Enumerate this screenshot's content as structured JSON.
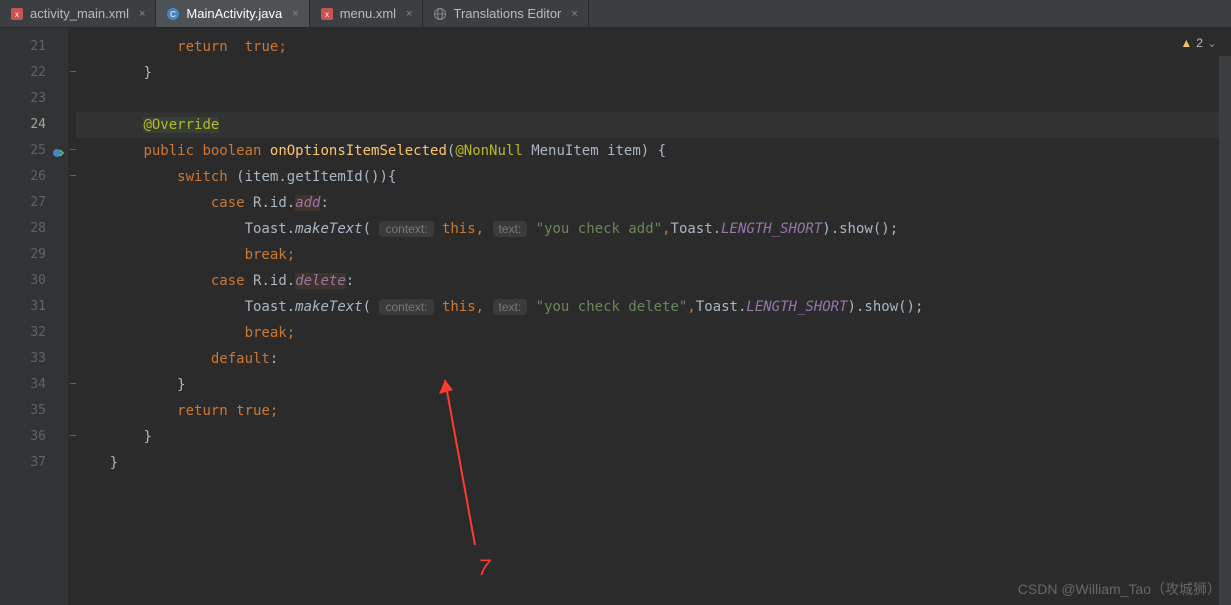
{
  "tabs": [
    {
      "label": "activity_main.xml",
      "icon": "xml-file-icon",
      "active": false
    },
    {
      "label": "MainActivity.java",
      "icon": "java-class-icon",
      "active": true
    },
    {
      "label": "menu.xml",
      "icon": "xml-file-icon",
      "active": false
    },
    {
      "label": "Translations Editor",
      "icon": "globe-icon",
      "active": false
    }
  ],
  "warnings": {
    "count": "2"
  },
  "gutter": {
    "start": 21,
    "end": 37,
    "current": 24,
    "override_marker_line": 25
  },
  "code": {
    "line21": {
      "indent": "            ",
      "kw": "return",
      "sp": "  ",
      "val": "true",
      "semi": ";"
    },
    "line22": {
      "indent": "        ",
      "brace": "}"
    },
    "line23": {
      "indent": ""
    },
    "line24": {
      "indent": "        ",
      "annot": "@Override"
    },
    "line25": {
      "indent": "        ",
      "pub": "public ",
      "bool": "boolean ",
      "method": "onOptionsItemSelected",
      "open": "(",
      "ann": "@NonNull ",
      "type": "MenuItem ",
      "param": "item",
      "close": ") {",
      "close_brace": " {"
    },
    "line26": {
      "indent": "            ",
      "kw": "switch ",
      "open": "(",
      "obj": "item",
      "dot": ".",
      "call": "getItemId",
      "paren": "()",
      "close": "){"
    },
    "line27": {
      "indent": "                ",
      "kw": "case ",
      "cls": "R",
      "d1": ".",
      "ns": "id",
      "d2": ".",
      "fld": "add",
      "colon": ":"
    },
    "line28": {
      "indent": "                    ",
      "cls": "Toast",
      "dot": ".",
      "mthd": "makeText",
      "open": "( ",
      "hint1": "context:",
      "sp1": " ",
      "thiskw": "this",
      "comma1": ", ",
      "hint2": "text:",
      "sp2": " ",
      "str": "\"you check add\"",
      "comma2": ",",
      "cls2": "Toast",
      "dot2": ".",
      "const": "LENGTH_SHORT",
      "close": ").",
      "show": "show",
      "end": "();"
    },
    "line29": {
      "indent": "                    ",
      "kw": "break",
      "semi": ";"
    },
    "line30": {
      "indent": "                ",
      "kw": "case ",
      "cls": "R",
      "d1": ".",
      "ns": "id",
      "d2": ".",
      "fld": "delete",
      "colon": ":"
    },
    "line31": {
      "indent": "                    ",
      "cls": "Toast",
      "dot": ".",
      "mthd": "makeText",
      "open": "( ",
      "hint1": "context:",
      "sp1": " ",
      "thiskw": "this",
      "comma1": ", ",
      "hint2": "text:",
      "sp2": " ",
      "str": "\"you check delete\"",
      "comma2": ",",
      "cls2": "Toast",
      "dot2": ".",
      "const": "LENGTH_SHORT",
      "close": ").",
      "show": "show",
      "end": "();"
    },
    "line32": {
      "indent": "                    ",
      "kw": "break",
      "semi": ";"
    },
    "line33": {
      "indent": "                ",
      "kw": "default",
      "colon": ":"
    },
    "line34": {
      "indent": "            ",
      "brace": "}"
    },
    "line35": {
      "indent": "            ",
      "kw": "return ",
      "val": "true",
      "semi": ";"
    },
    "line36": {
      "indent": "        ",
      "brace": "}"
    },
    "line37": {
      "indent": "    ",
      "brace": "}"
    }
  },
  "annotations": {
    "seven": "7",
    "watermark": "CSDN @William_Tao（攻城狮）"
  }
}
